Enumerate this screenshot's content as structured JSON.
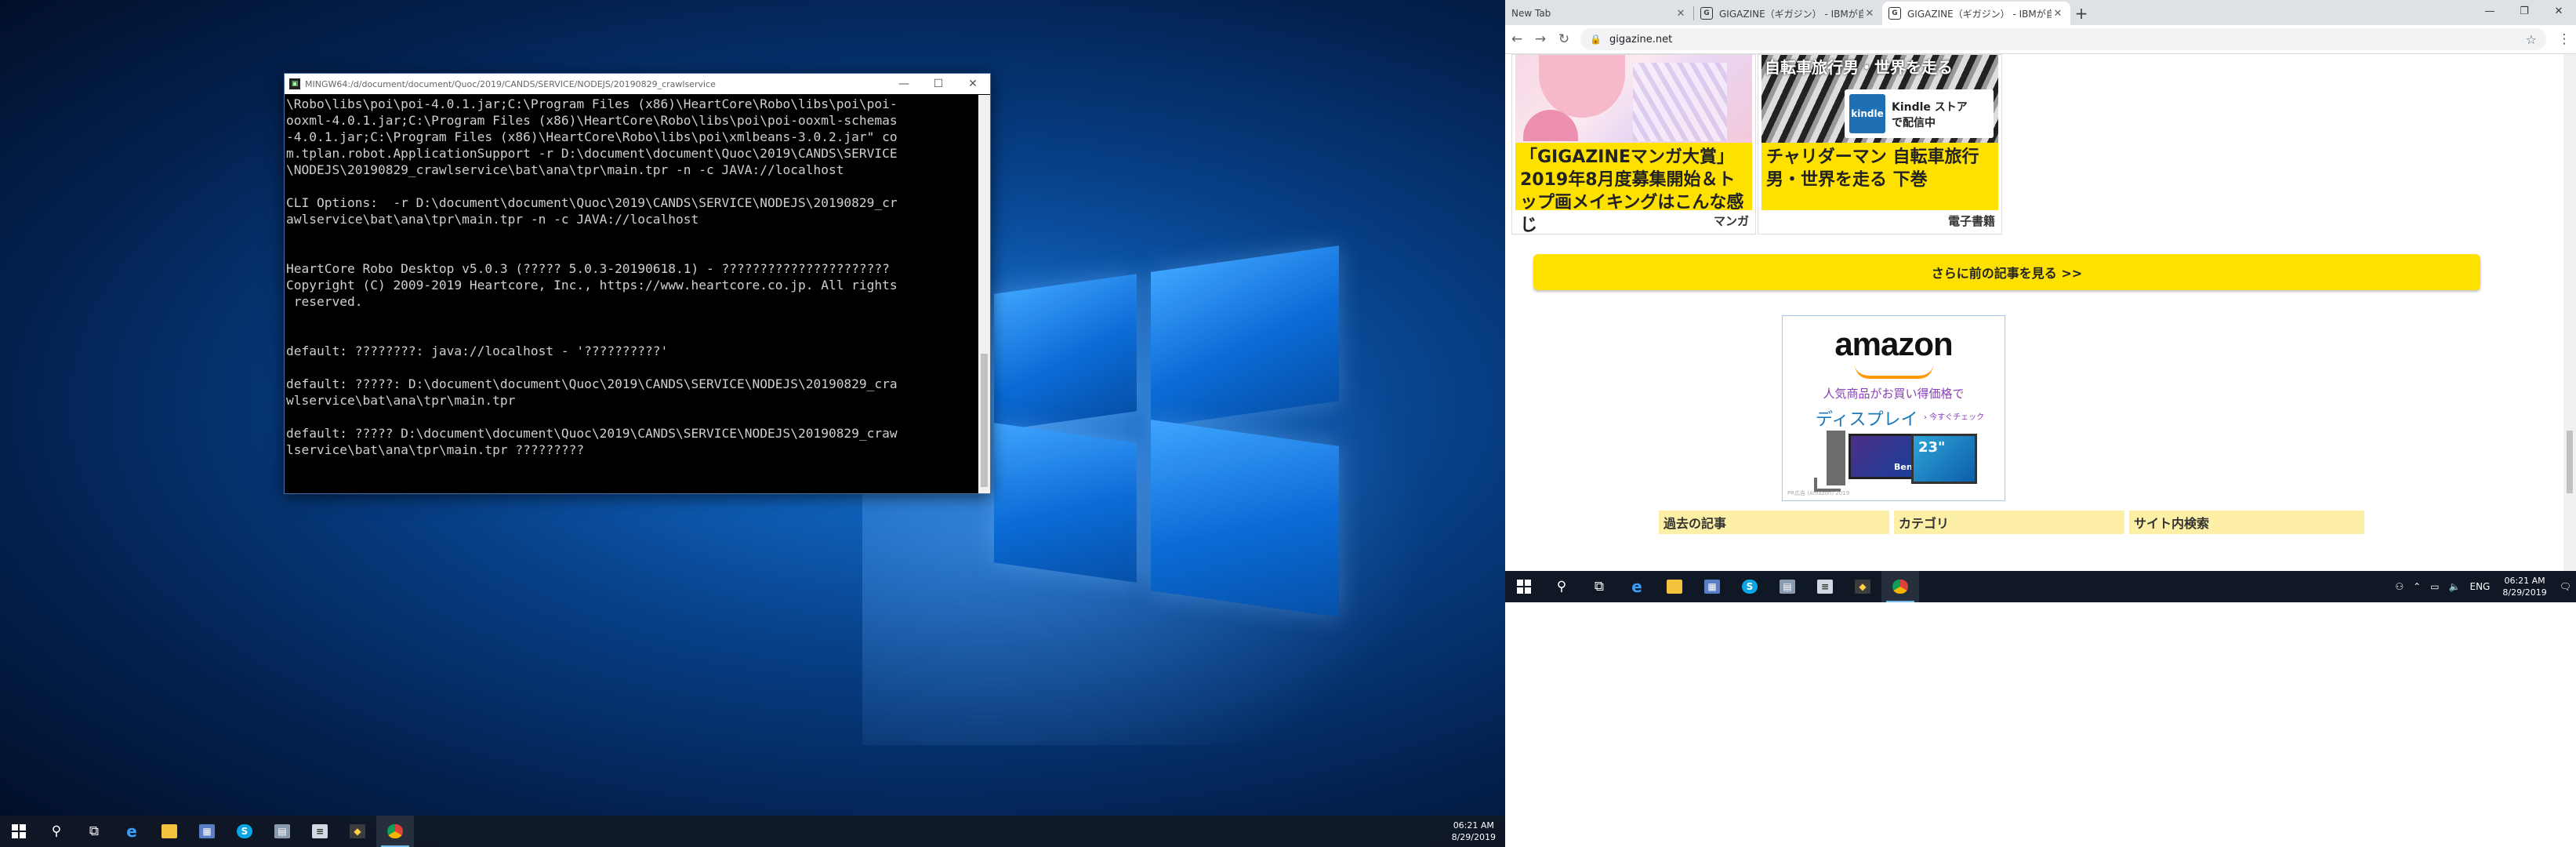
{
  "terminal": {
    "title": "MINGW64:/d/document/document/Quoc/2019/CANDS/SERVICE/NODEJS/20190829_crawlservice",
    "lines": [
      "\\Robo\\libs\\poi\\poi-4.0.1.jar;C:\\Program Files (x86)\\HeartCore\\Robo\\libs\\poi\\poi-",
      "ooxml-4.0.1.jar;C:\\Program Files (x86)\\HeartCore\\Robo\\libs\\poi\\poi-ooxml-schemas",
      "-4.0.1.jar;C:\\Program Files (x86)\\HeartCore\\Robo\\libs\\poi\\xmlbeans-3.0.2.jar\" co",
      "m.tplan.robot.ApplicationSupport -r D:\\document\\document\\Quoc\\2019\\CANDS\\SERVICE",
      "\\NODEJS\\20190829_crawlservice\\bat\\ana\\tpr\\main.tpr -n -c JAVA://localhost",
      "",
      "CLI Options:  -r D:\\document\\document\\Quoc\\2019\\CANDS\\SERVICE\\NODEJS\\20190829_cr",
      "awlservice\\bat\\ana\\tpr\\main.tpr -n -c JAVA://localhost",
      "",
      "",
      "HeartCore Robo Desktop v5.0.3 (????? 5.0.3-20190618.1) - ??????????????????????",
      "Copyright (C) 2009-2019 Heartcore, Inc., https://www.heartcore.co.jp. All rights",
      " reserved.",
      "",
      "",
      "default: ????????: java://localhost - '??????????'",
      "",
      "default: ?????: D:\\document\\document\\Quoc\\2019\\CANDS\\SERVICE\\NODEJS\\20190829_cra",
      "wlservice\\bat\\ana\\tpr\\main.tpr",
      "",
      "default: ????? D:\\document\\document\\Quoc\\2019\\CANDS\\SERVICE\\NODEJS\\20190829_craw",
      "lservice\\bat\\ana\\tpr\\main.tpr ?????????"
    ]
  },
  "left_taskbar": {
    "time": "06:21 AM",
    "date": "8/29/2019"
  },
  "browser": {
    "tabs": [
      {
        "label": "New Tab",
        "favicon": ""
      },
      {
        "label": "GIGAZINE（ギガジン） - IBMが自…",
        "favicon": "G"
      },
      {
        "label": "GIGAZINE（ギガジン） - IBMが自…",
        "favicon": "G"
      }
    ],
    "url": "gigazine.net",
    "cards": [
      {
        "caption": "「GIGAZINEマンガ大賞」2019年8月度募集開始＆トップ画メイキングはこんな感じ",
        "category": "マンガ"
      },
      {
        "caption": "チャリダーマン 自転車旅行 男・世界を走る 下巻",
        "category": "電子書籍",
        "overlay_title": "自転車旅行男・世界を走る",
        "kindle": "Kindle ストア",
        "kindle_sub": "で配信中"
      }
    ],
    "more_button": "さらに前の記事を見る >>",
    "ad": {
      "logo": "amazon",
      "line1": "人気商品がお買い得価格で",
      "line2": "ディスプレイ",
      "cta": "› 今すぐチェック",
      "monitor_size": "23\"",
      "fine": "PR広告 (Amazon) 2019"
    },
    "footer": {
      "past": "過去の記事",
      "category": "カテゴリ",
      "search": "サイト内検索"
    }
  },
  "right_taskbar": {
    "lang": "ENG",
    "time": "06:21 AM",
    "date": "8/29/2019"
  }
}
